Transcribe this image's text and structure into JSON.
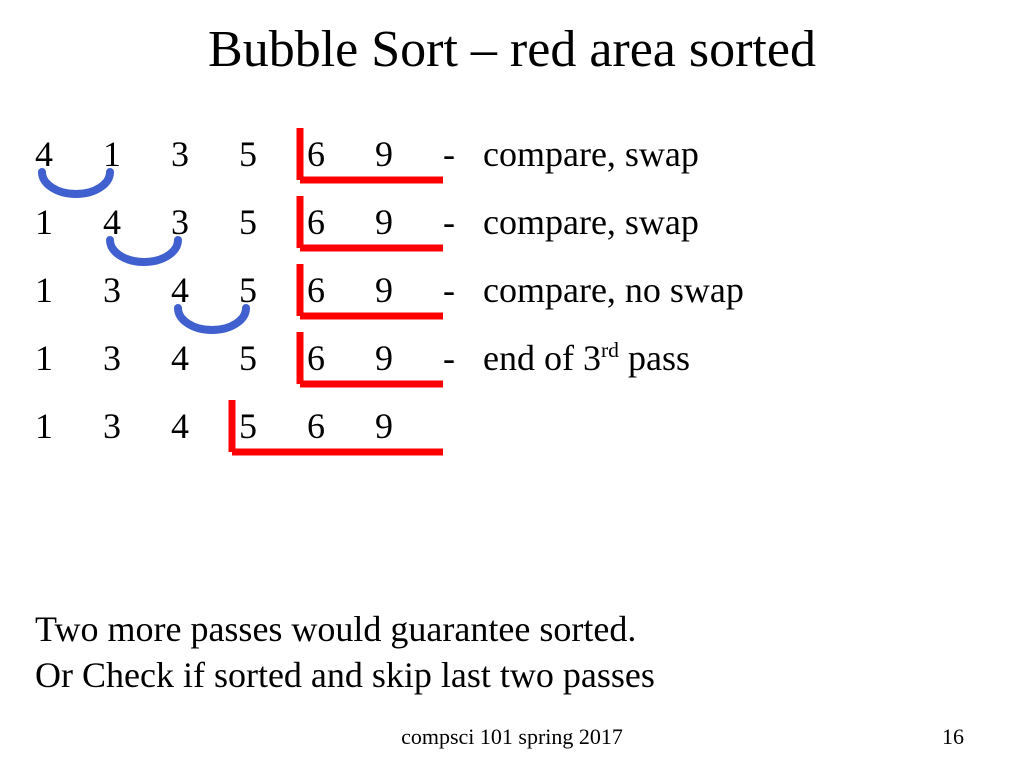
{
  "title": "Bubble Sort – red area sorted",
  "rows": [
    {
      "cells": [
        "4",
        "1",
        "3",
        "5",
        "6",
        "9"
      ],
      "dash": "-",
      "op_html": "compare, swap"
    },
    {
      "cells": [
        "1",
        "4",
        "3",
        "5",
        "6",
        "9"
      ],
      "dash": "-",
      "op_html": "compare, swap"
    },
    {
      "cells": [
        "1",
        "3",
        "4",
        "5",
        "6",
        "9"
      ],
      "dash": "-",
      "op_html": "compare, no swap"
    },
    {
      "cells": [
        "1",
        "3",
        "4",
        "5",
        "6",
        "9"
      ],
      "dash": "-",
      "op_html": "end of 3<sup>rd</sup> pass"
    },
    {
      "cells": [
        "1",
        "3",
        "4",
        "5",
        "6",
        "9"
      ],
      "dash": "",
      "op_html": ""
    }
  ],
  "summary_line1": "Two more passes would guarantee sorted.",
  "summary_line2": "Or Check if sorted and skip last two passes",
  "footer_course": "compsci 101 spring 2017",
  "footer_page": "16",
  "colors": {
    "red": "#ff0000",
    "blue": "#4060d0"
  }
}
